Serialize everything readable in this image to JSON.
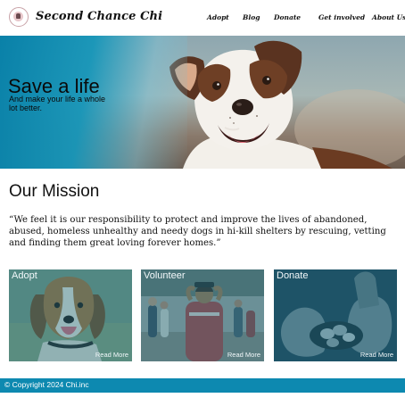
{
  "header": {
    "brand": "Second Chance Chi",
    "logo_icon": "dog-logo-icon",
    "nav": [
      {
        "label": "Adopt"
      },
      {
        "label": "Blog"
      },
      {
        "label": "Donate"
      },
      {
        "label": "Get involved"
      },
      {
        "label": "About Us"
      }
    ]
  },
  "hero": {
    "title": "Save a life",
    "subtitle": "And make your life a whole lot better.",
    "accent_color": "#0780a8"
  },
  "mission": {
    "title": "Our Mission",
    "quote": "“We feel it is our responsibility to protect and improve the lives of abandoned, abused, homeless unhealthy and needy dogs in hi-kill shelters by rescuing, vetting and finding them great loving forever homes.”"
  },
  "cards": [
    {
      "title": "Adopt",
      "more": "Read More"
    },
    {
      "title": "Volunteer",
      "more": "Read More"
    },
    {
      "title": "Donate",
      "more": "Read More"
    }
  ],
  "footer": {
    "copyright": "© Copyright 2024 Chi.inc",
    "color": "#0d89b0"
  }
}
